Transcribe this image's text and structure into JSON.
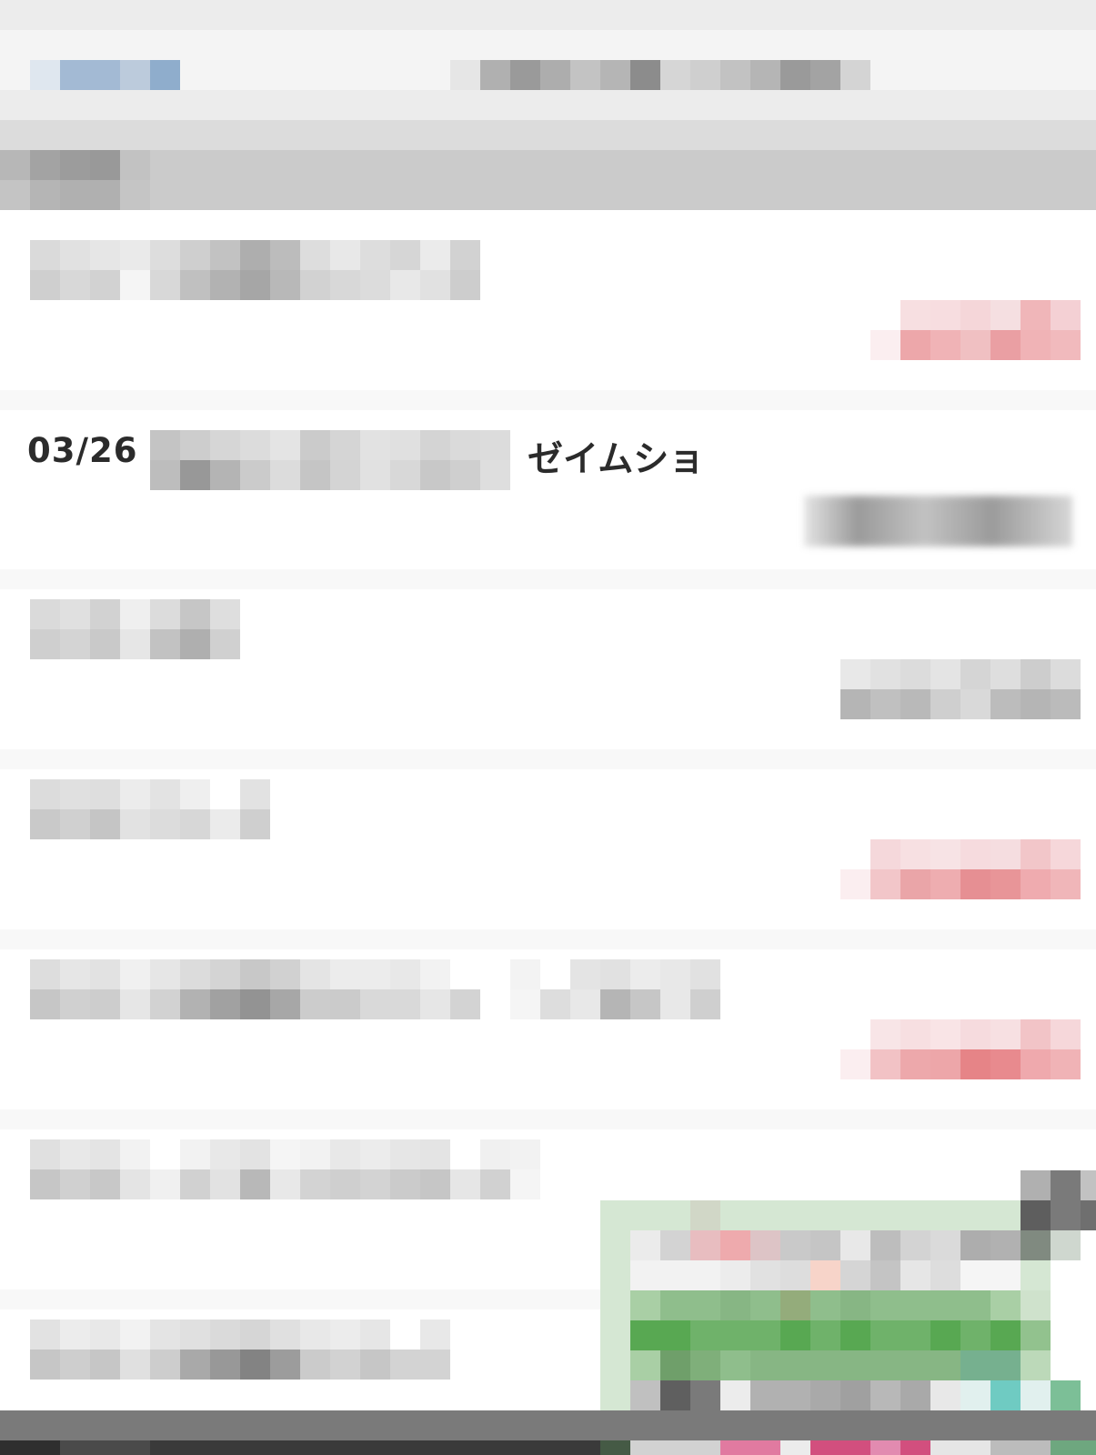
{
  "transaction_highlighted": {
    "date": "03/26",
    "payee_suffix": "ゼイムショ"
  },
  "mosaic_palette": {
    "blue": [
      "#dfe7ef",
      "#a3bad4",
      "#bccbdc",
      "#8fadcc"
    ],
    "gray": [
      "#f4f4f4",
      "#ebebeb",
      "#e2e2e2",
      "#d7d7d7",
      "#cbcbcb",
      "#bdbdbd",
      "#a9a9a9",
      "#959595"
    ],
    "red": [
      "#f7e6e8",
      "#f4d3d6",
      "#f0b9bc",
      "#eaa1a5",
      "#e48a8e"
    ],
    "green": [
      "#d5e7d3",
      "#a9cfa5",
      "#8fbe8c",
      "#6fb26a",
      "#58a852"
    ]
  }
}
